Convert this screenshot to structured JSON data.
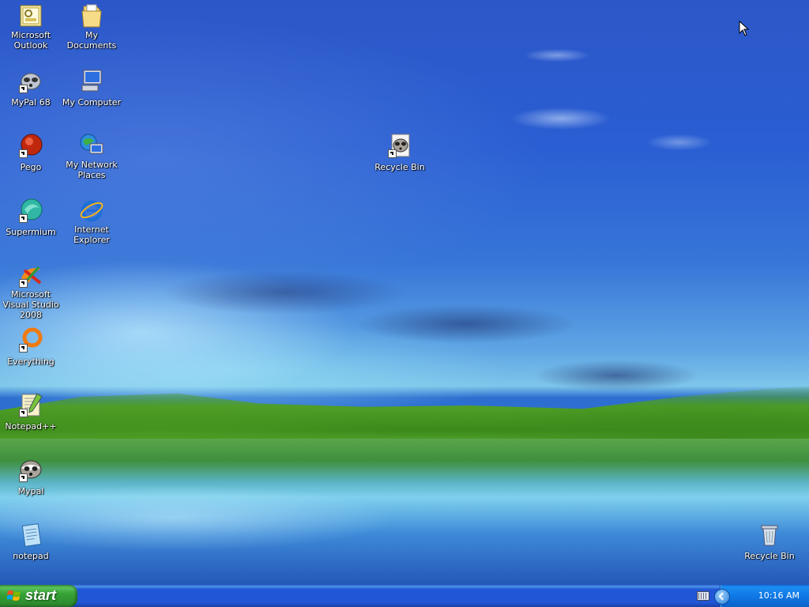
{
  "desktop": {
    "icons": [
      {
        "label": "Microsoft Outlook",
        "icon": "outlook-icon",
        "shortcut": false
      },
      {
        "label": "My Documents",
        "icon": "folder-icon",
        "shortcut": false
      },
      {
        "label": "MyPal 68",
        "icon": "mypal-icon",
        "shortcut": true
      },
      {
        "label": "My Computer",
        "icon": "computer-icon",
        "shortcut": false
      },
      {
        "label": "Pego",
        "icon": "pego-icon",
        "shortcut": true
      },
      {
        "label": "My Network Places",
        "icon": "network-icon",
        "shortcut": false
      },
      {
        "label": "Recycle Bin",
        "icon": "raccoon-icon",
        "shortcut": true
      },
      {
        "label": "Supermium",
        "icon": "supermium-icon",
        "shortcut": true
      },
      {
        "label": "Internet Explorer",
        "icon": "ie-icon",
        "shortcut": false
      },
      {
        "label": "Microsoft Visual Studio 2008",
        "icon": "visual-studio-icon",
        "shortcut": true
      },
      {
        "label": "Everything",
        "icon": "everything-icon",
        "shortcut": true
      },
      {
        "label": "Notepad++",
        "icon": "notepadpp-icon",
        "shortcut": true
      },
      {
        "label": "Mypal",
        "icon": "mypal-icon",
        "shortcut": true
      },
      {
        "label": "notepad",
        "icon": "notepad-icon",
        "shortcut": false
      },
      {
        "label": "Recycle Bin",
        "icon": "recycle-bin-icon",
        "shortcut": false
      }
    ]
  },
  "taskbar": {
    "start_label": "start",
    "clock": "10:16 AM"
  },
  "colors": {
    "taskbar": "#2157d7",
    "start_button": "#37a337",
    "tray": "#0f78e6"
  }
}
